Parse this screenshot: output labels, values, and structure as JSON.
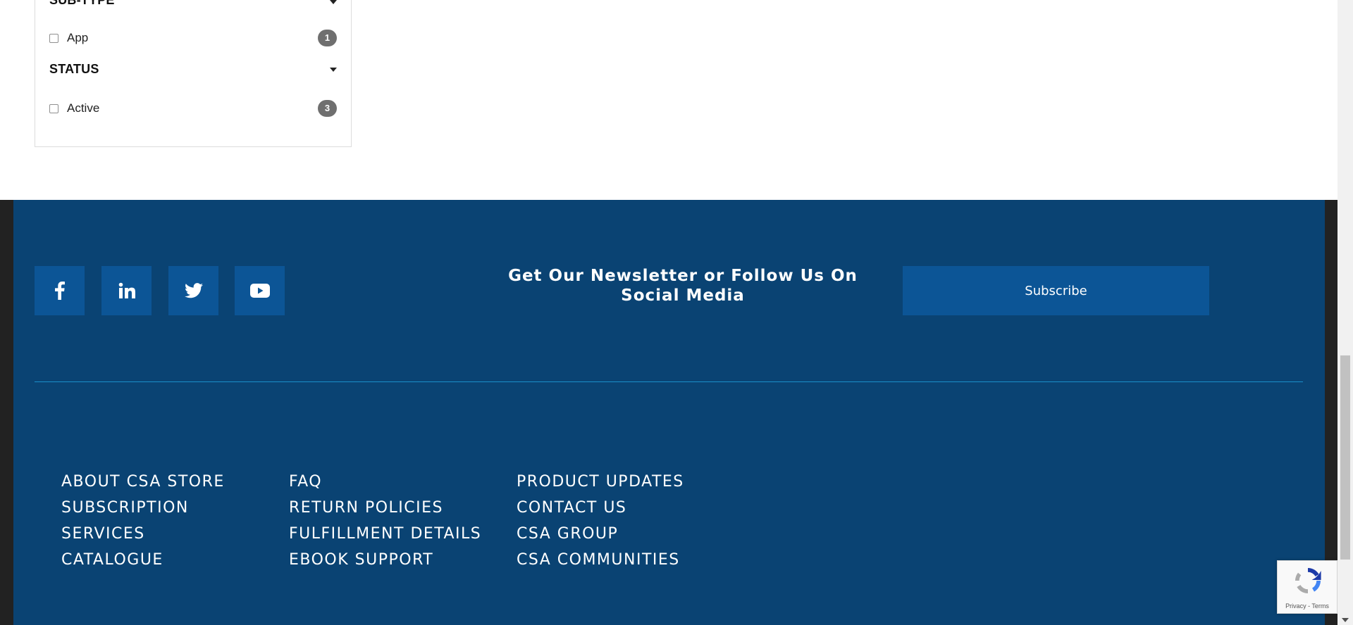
{
  "filters": {
    "subtype": {
      "heading": "SUB-TYPE",
      "options": [
        {
          "label": "App",
          "count": "1"
        }
      ]
    },
    "status": {
      "heading": "STATUS",
      "options": [
        {
          "label": "Active",
          "count": "3"
        }
      ]
    }
  },
  "footer": {
    "social": [
      {
        "icon": "facebook-icon"
      },
      {
        "icon": "linkedin-icon"
      },
      {
        "icon": "twitter-icon"
      },
      {
        "icon": "youtube-icon"
      }
    ],
    "newsletter_text": "Get Our Newsletter or Follow Us On Social Media",
    "subscribe_label": "Subscribe",
    "links": {
      "col1": [
        "ABOUT CSA STORE",
        "SUBSCRIPTION",
        "SERVICES",
        "CATALOGUE"
      ],
      "col2": [
        "FAQ",
        "RETURN POLICIES",
        "FULFILLMENT DETAILS",
        "EBOOK SUPPORT"
      ],
      "col3": [
        "PRODUCT UPDATES",
        "CONTACT US",
        "CSA GROUP",
        "CSA COMMUNITIES"
      ]
    },
    "colors": {
      "background": "#0a4373",
      "button": "#0c5596",
      "divider": "#1b8fc9"
    }
  },
  "recaptcha": {
    "terms_text": "Privacy - Terms"
  }
}
